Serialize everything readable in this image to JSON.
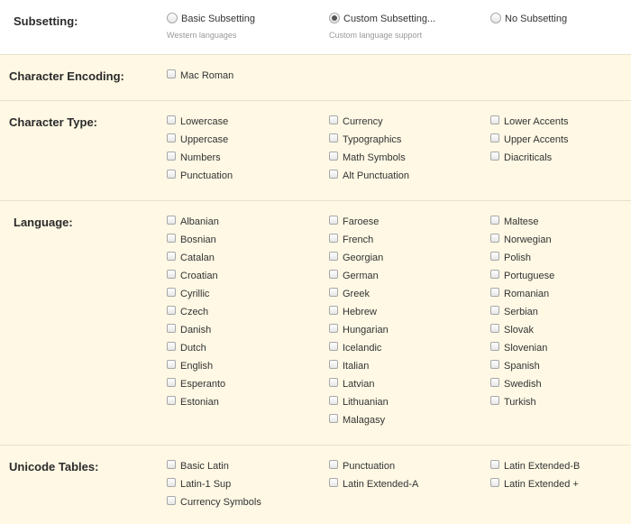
{
  "subsetting": {
    "label": "Subsetting:",
    "options": [
      {
        "label": "Basic Subsetting",
        "sub": "Western languages",
        "checked": false
      },
      {
        "label": "Custom Subsetting...",
        "sub": "Custom language support",
        "checked": true
      },
      {
        "label": "No Subsetting",
        "sub": "",
        "checked": false
      }
    ]
  },
  "encoding": {
    "label": "Character Encoding:",
    "options": [
      "Mac Roman"
    ]
  },
  "char_type": {
    "label": "Character Type:",
    "col1": [
      "Lowercase",
      "Uppercase",
      "Numbers",
      "Punctuation"
    ],
    "col2": [
      "Currency",
      "Typographics",
      "Math Symbols",
      "Alt Punctuation"
    ],
    "col3": [
      "Lower Accents",
      "Upper Accents",
      "Diacriticals"
    ]
  },
  "language": {
    "label": "Language:",
    "col1": [
      "Albanian",
      "Bosnian",
      "Catalan",
      "Croatian",
      "Cyrillic",
      "Czech",
      "Danish",
      "Dutch",
      "English",
      "Esperanto",
      "Estonian"
    ],
    "col2": [
      "Faroese",
      "French",
      "Georgian",
      "German",
      "Greek",
      "Hebrew",
      "Hungarian",
      "Icelandic",
      "Italian",
      "Latvian",
      "Lithuanian",
      "Malagasy"
    ],
    "col3": [
      "Maltese",
      "Norwegian",
      "Polish",
      "Portuguese",
      "Romanian",
      "Serbian",
      "Slovak",
      "Slovenian",
      "Spanish",
      "Swedish",
      "Turkish"
    ]
  },
  "unicode": {
    "label": "Unicode Tables:",
    "col1": [
      "Basic Latin",
      "Latin-1 Sup",
      "Currency Symbols"
    ],
    "col2": [
      "Punctuation",
      "Latin Extended-A"
    ],
    "col3": [
      "Latin Extended-B",
      "Latin Extended +"
    ]
  }
}
